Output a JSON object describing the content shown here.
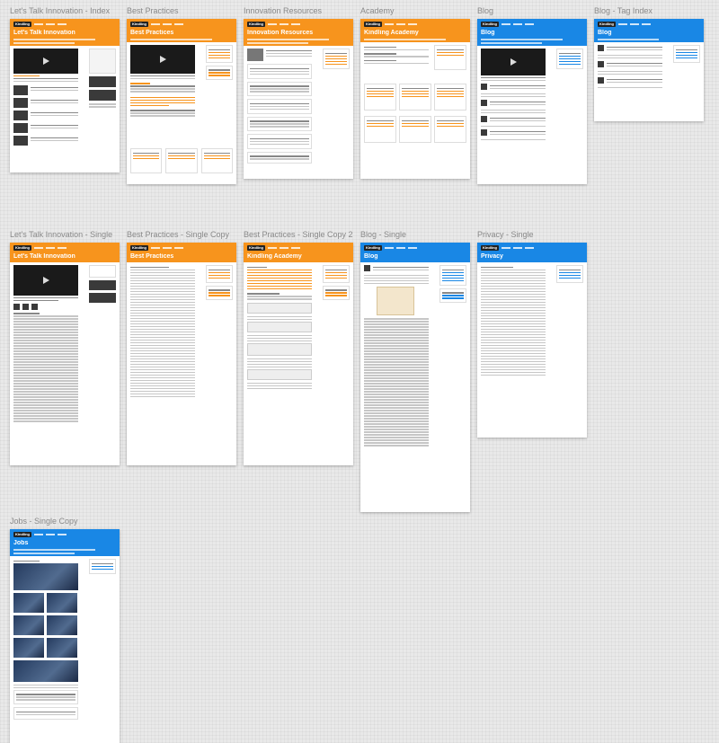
{
  "artboards": {
    "lti_index": {
      "title": "Let's Talk Innovation - Index",
      "logo": "Kindling",
      "header": "Let's Talk Innovation"
    },
    "best_practices": {
      "title": "Best Practices",
      "logo": "Kindling",
      "header": "Best Practices"
    },
    "innovation_resources": {
      "title": "Innovation Resources",
      "logo": "Kindling",
      "header": "Innovation Resources"
    },
    "academy": {
      "title": "Academy",
      "logo": "Kindling",
      "header": "Kindling Academy"
    },
    "blog": {
      "title": "Blog",
      "logo": "Kindling",
      "header": "Blog"
    },
    "blog_tag_index": {
      "title": "Blog - Tag Index",
      "logo": "Kindling",
      "header": "Blog"
    },
    "lti_single": {
      "title": "Let's Talk Innovation - Single",
      "logo": "Kindling",
      "header": "Let's Talk Innovation"
    },
    "bp_single_copy": {
      "title": "Best Practices - Single Copy",
      "logo": "Kindling",
      "header": "Best Practices"
    },
    "bp_single_copy2": {
      "title": "Best Practices - Single Copy 2",
      "logo": "Kindling",
      "header": "Kindling Academy"
    },
    "blog_single": {
      "title": "Blog - Single",
      "logo": "Kindling",
      "header": "Blog"
    },
    "privacy_single": {
      "title": "Privacy - Single",
      "logo": "Kindling",
      "header": "Privacy"
    },
    "jobs_single_copy": {
      "title": "Jobs - Single Copy",
      "logo": "Kindling",
      "header": "Jobs"
    }
  },
  "colors": {
    "orange": "#f7941d",
    "blue": "#1987e5",
    "canvas": "#e9e9e9"
  }
}
